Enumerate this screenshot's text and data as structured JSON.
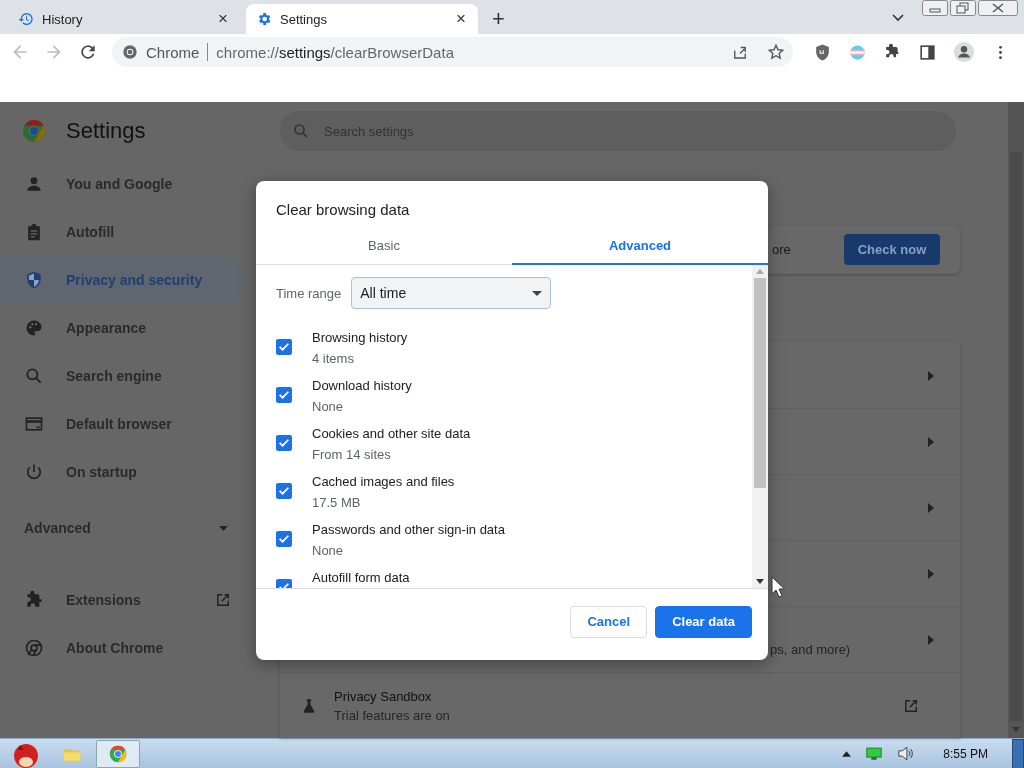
{
  "browser": {
    "tabs": [
      {
        "title": "History",
        "kind": "history",
        "selected": false,
        "close": "×"
      },
      {
        "title": "Settings",
        "kind": "settings",
        "selected": true,
        "close": "×"
      }
    ],
    "new_tab": "+",
    "nav": {
      "back": {
        "disabled": true
      },
      "forward": {
        "disabled": true
      }
    },
    "omnibox": {
      "site": "Chrome",
      "url_scheme": "chrome://",
      "url_host": "settings",
      "url_path": "/clearBrowserData"
    }
  },
  "settings": {
    "title": "Settings",
    "search": {
      "placeholder": "Search settings"
    },
    "sidebar": {
      "items": [
        {
          "label": "You and Google",
          "selected": false
        },
        {
          "label": "Autofill",
          "selected": false
        },
        {
          "label": "Privacy and security",
          "selected": true
        },
        {
          "label": "Appearance",
          "selected": false
        },
        {
          "label": "Search engine",
          "selected": false
        },
        {
          "label": "Default browser",
          "selected": false
        },
        {
          "label": "On startup",
          "selected": false
        }
      ],
      "advanced": {
        "label": "Advanced",
        "expanded": false
      },
      "links": [
        {
          "label": "Extensions",
          "external": true
        },
        {
          "label": "About Chrome",
          "external": false
        }
      ]
    },
    "safety_check": {
      "text": "ore",
      "button": "Check now"
    },
    "privacy_rows": [
      {
        "kind": "submenu"
      },
      {
        "kind": "submenu"
      },
      {
        "kind": "submenu"
      },
      {
        "kind": "submenu"
      },
      {
        "kind": "submenu",
        "text": "ps, and more)"
      },
      {
        "kind": "external",
        "title": "Privacy Sandbox",
        "subtitle": "Trial features are on"
      }
    ]
  },
  "dialog": {
    "title": "Clear browsing data",
    "tabs": [
      {
        "label": "Basic",
        "selected": false
      },
      {
        "label": "Advanced",
        "selected": true
      }
    ],
    "time_range": {
      "label": "Time range",
      "value": "All time"
    },
    "items": [
      {
        "label": "Browsing history",
        "detail": "4 items",
        "checked": true
      },
      {
        "label": "Download history",
        "detail": "None",
        "checked": true
      },
      {
        "label": "Cookies and other site data",
        "detail": "From 14 sites",
        "checked": true
      },
      {
        "label": "Cached images and files",
        "detail": "17.5 MB",
        "checked": true
      },
      {
        "label": "Passwords and other sign-in data",
        "detail": "None",
        "checked": true
      },
      {
        "label": "Autofill form data",
        "checked": true
      }
    ],
    "buttons": [
      {
        "label": "Cancel",
        "kind": "secondary"
      },
      {
        "label": "Clear data",
        "kind": "primary"
      }
    ]
  },
  "taskbar": {
    "clock": "8:55 PM"
  }
}
